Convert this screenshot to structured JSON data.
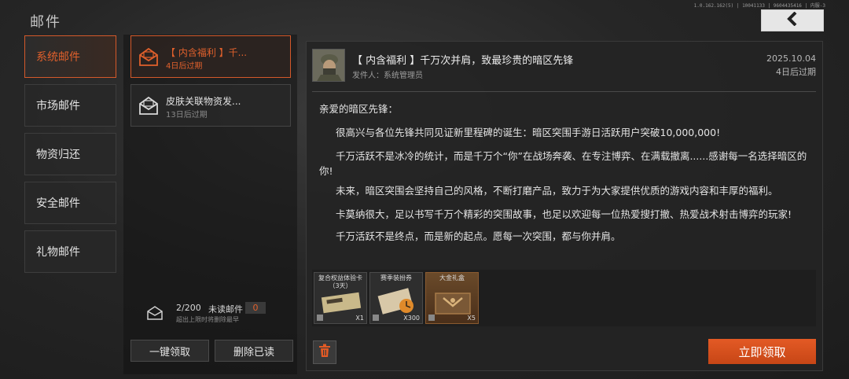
{
  "header": {
    "title": "邮件",
    "version": "1.0.162.162(5) | 10041133 | 9604435416 | 内服-3",
    "back_icon": "chevron-left-icon"
  },
  "categories": [
    {
      "label": "系统邮件",
      "active": true
    },
    {
      "label": "市场邮件",
      "active": false
    },
    {
      "label": "物资归还",
      "active": false
    },
    {
      "label": "安全邮件",
      "active": false
    },
    {
      "label": "礼物邮件",
      "active": false
    }
  ],
  "mails": [
    {
      "title": "【 内含福利 】千...",
      "expire": "4日后过期",
      "icon": "open-envelope-icon",
      "active": true
    },
    {
      "title": "皮肤关联物资发...",
      "expire": "13日后过期",
      "icon": "open-envelope-icon",
      "active": false
    }
  ],
  "mailbox": {
    "count": "2/200",
    "unread_label": "未读邮件",
    "unread_count": "0",
    "hint": "超出上限时将删除最早"
  },
  "list_actions": {
    "claim_all": "一键领取",
    "delete_read": "删除已读"
  },
  "detail": {
    "title": "【 内含福利 】千万次并肩，致最珍贵的暗区先锋",
    "sender": "发件人：系统管理员",
    "date": "2025.10.04",
    "expire": "4日后过期",
    "paragraphs": [
      "亲爱的暗区先锋：",
      "很高兴与各位先锋共同见证新里程碑的诞生：暗区突围手游日活跃用户突破10,000,000!",
      "千万活跃不是冰冷的统计，而是千万个“你”在战场奔袭、在专注博弈、在满载撤离......感谢每一名选择暗区的你!",
      "未来，暗区突围会坚持自己的风格，不断打磨产品，致力于为大家提供优质的游戏内容和丰厚的福利。",
      "卡莫纳很大，足以书写千万个精彩的突围故事，也足以欢迎每一位热爱搜打撤、热爱战术射击博弈的玩家!",
      "千万活跃不是终点，而是新的起点。愿每一次突围，都与你并肩。"
    ],
    "rewards": [
      {
        "name": "复合权益体验卡（3天）",
        "qty": "X1"
      },
      {
        "name": "赛季装扮券",
        "qty": "X300"
      },
      {
        "name": "大金礼盒",
        "qty": "X5"
      }
    ],
    "claim_label": "立即领取"
  },
  "colors": {
    "accent": "#e0602c",
    "claim_button": "#d24f1c"
  }
}
